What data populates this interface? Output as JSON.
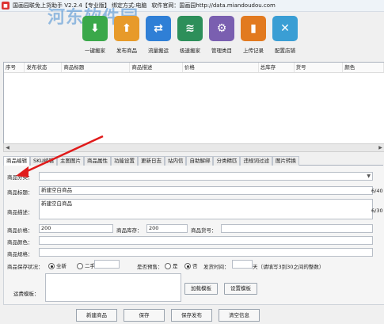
{
  "title": {
    "app_name": "国画园联免上货助手 V2.2.4【专业版】 绑定方式:电脑",
    "website": "软件官网：国画园http://data.miandoudou.com"
  },
  "watermark": "河东软件园",
  "toolbar": [
    {
      "label": "一键搬家",
      "icon": "download-icon",
      "color": "#3aa84a"
    },
    {
      "label": "发布商品",
      "icon": "publish-icon",
      "color": "#e79a2a"
    },
    {
      "label": "流量搬运",
      "icon": "transfer-icon",
      "color": "#2f7fd6"
    },
    {
      "label": "极速搬家",
      "icon": "layers-icon",
      "color": "#2d8f5a"
    },
    {
      "label": "管理类目",
      "icon": "gear-icon",
      "color": "#7a5fb0"
    },
    {
      "label": "上传记录",
      "icon": "bookmark-icon",
      "color": "#e27a1f"
    },
    {
      "label": "配置店铺",
      "icon": "tools-icon",
      "color": "#3a9ed4"
    }
  ],
  "grid": {
    "columns": [
      "序号",
      "发布状态",
      "商品标题",
      "商品描述",
      "价格",
      "总库存",
      "货号",
      "颜色"
    ]
  },
  "tabs": [
    "商品编辑",
    "SKU编辑",
    "主图图片",
    "商品属性",
    "功能设置",
    "更新日志",
    "站内信",
    "自助解绑",
    "分类精匹",
    "违规词过滤",
    "图片转换"
  ],
  "form": {
    "category_label": "商品分类：",
    "category_value": "",
    "title_label": "商品标题：",
    "title_value": "新建空白商品",
    "title_counter": "6/40",
    "desc_label": "商品描述：",
    "desc_value": "新建空白商品",
    "desc_counter": "6/30",
    "price_label": "商品价格：",
    "price_value": "200",
    "stock_label": "商品库存：",
    "stock_value": "200",
    "sku_label": "商品货号：",
    "sku_value": "",
    "color_label": "商品颜色：",
    "spec_label": "商品规格：",
    "condition_label": "商品保存状况：",
    "condition_new": "全新",
    "condition_used": "二手",
    "presale_label": "是否预售：",
    "presale_yes": "是",
    "presale_no": "否",
    "ship_label": "发货时间：",
    "ship_unit": "天（请填写3到30之间的整数）",
    "template_label": "运费模板：",
    "load_template": "加载模板",
    "set_template": "设置模板"
  },
  "bottom_buttons": [
    "新建商品",
    "保存",
    "保存发布",
    "清空信息"
  ]
}
